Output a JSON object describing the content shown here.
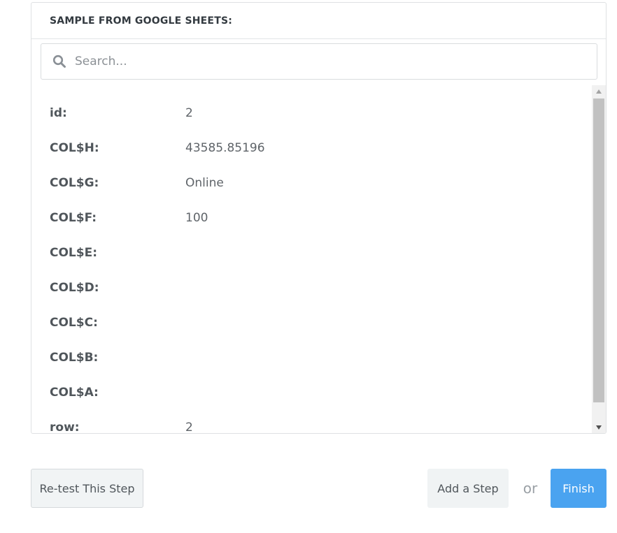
{
  "panel": {
    "title": "SAMPLE FROM GOOGLE SHEETS:"
  },
  "search": {
    "placeholder": "Search...",
    "icon": "search-icon"
  },
  "fields": [
    {
      "key": "id:",
      "value": "2"
    },
    {
      "key": "COL$H:",
      "value": "43585.85196"
    },
    {
      "key": "COL$G:",
      "value": "Online"
    },
    {
      "key": "COL$F:",
      "value": "100"
    },
    {
      "key": "COL$E:",
      "value": ""
    },
    {
      "key": "COL$D:",
      "value": ""
    },
    {
      "key": "COL$C:",
      "value": ""
    },
    {
      "key": "COL$B:",
      "value": ""
    },
    {
      "key": "COL$A:",
      "value": ""
    },
    {
      "key": "row:",
      "value": "2"
    }
  ],
  "actions": {
    "retest_label": "Re-test This Step",
    "add_step_label": "Add a Step",
    "or_label": "or",
    "finish_label": "Finish"
  },
  "colors": {
    "accent": "#4aa3f0",
    "secondary_button": "#f1f4f5"
  }
}
